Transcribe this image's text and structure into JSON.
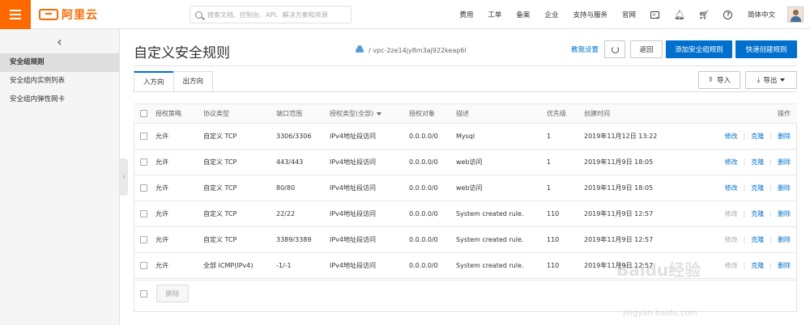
{
  "topbar": {
    "logo_text": "阿里云",
    "search_placeholder": "搜索文档、控制台、API、解决方案和资源",
    "nav": [
      "费用",
      "工单",
      "备案",
      "企业",
      "支持与服务",
      "官网"
    ],
    "language": "简体中文",
    "icons": [
      "terminal-icon",
      "bell-icon",
      "cart-icon",
      "help-icon"
    ]
  },
  "sidebar": {
    "back_glyph": "‹",
    "items": [
      {
        "label": "安全组规则",
        "active": true
      },
      {
        "label": "安全组内实例列表",
        "active": false
      },
      {
        "label": "安全组内弹性网卡",
        "active": false
      }
    ]
  },
  "header": {
    "title": "自定义安全规则",
    "vpc_path": "/ vpc-2ze14jy8m3aj922keap6l",
    "help_link": "教我设置",
    "back_button": "返回",
    "add_rule_button": "添加安全组规则",
    "quick_create_button": "快速创建规则"
  },
  "tabs": [
    {
      "label": "入方向",
      "active": true
    },
    {
      "label": "出方向",
      "active": false
    }
  ],
  "toolbar": {
    "import_label": "导入",
    "export_label": "导出"
  },
  "table": {
    "columns": [
      "授权策略",
      "协议类型",
      "端口范围",
      "授权类型(全部)",
      "授权对象",
      "描述",
      "优先级",
      "创建时间",
      "操作"
    ],
    "rows": [
      {
        "policy": "允许",
        "protocol": "自定义 TCP",
        "port": "3306/3306",
        "auth_type": "IPv4地址段访问",
        "auth_object": "0.0.0.0/0",
        "desc": "Mysql",
        "priority": "1",
        "created": "2019年11月12日 13:22",
        "edit": "修改",
        "clone": "克隆",
        "delete": "删除",
        "edit_disabled": false
      },
      {
        "policy": "允许",
        "protocol": "自定义 TCP",
        "port": "443/443",
        "auth_type": "IPv4地址段访问",
        "auth_object": "0.0.0.0/0",
        "desc": "web访问",
        "priority": "1",
        "created": "2019年11月9日 18:05",
        "edit": "修改",
        "clone": "克隆",
        "delete": "删除",
        "edit_disabled": false
      },
      {
        "policy": "允许",
        "protocol": "自定义 TCP",
        "port": "80/80",
        "auth_type": "IPv4地址段访问",
        "auth_object": "0.0.0.0/0",
        "desc": "web访问",
        "priority": "1",
        "created": "2019年11月9日 18:05",
        "edit": "修改",
        "clone": "克隆",
        "delete": "删除",
        "edit_disabled": false
      },
      {
        "policy": "允许",
        "protocol": "自定义 TCP",
        "port": "22/22",
        "auth_type": "IPv4地址段访问",
        "auth_object": "0.0.0.0/0",
        "desc": "System created rule.",
        "priority": "110",
        "created": "2019年11月9日 12:57",
        "edit": "修改",
        "clone": "克隆",
        "delete": "删除",
        "edit_disabled": true
      },
      {
        "policy": "允许",
        "protocol": "自定义 TCP",
        "port": "3389/3389",
        "auth_type": "IPv4地址段访问",
        "auth_object": "0.0.0.0/0",
        "desc": "System created rule.",
        "priority": "110",
        "created": "2019年11月9日 12:57",
        "edit": "修改",
        "clone": "克隆",
        "delete": "删除",
        "edit_disabled": true
      },
      {
        "policy": "允许",
        "protocol": "全部 ICMP(IPv4)",
        "port": "-1/-1",
        "auth_type": "IPv4地址段访问",
        "auth_object": "0.0.0.0/0",
        "desc": "System created rule.",
        "priority": "110",
        "created": "2019年11月9日 12:57",
        "edit": "修改",
        "clone": "克隆",
        "delete": "删除",
        "edit_disabled": true
      }
    ],
    "bulk_delete": "删除"
  },
  "watermark": {
    "main": "Baidu经验",
    "sub": "jingyan.baidu.com"
  },
  "colors": {
    "brand": "#ff6a00",
    "primary": "#0070cc"
  }
}
